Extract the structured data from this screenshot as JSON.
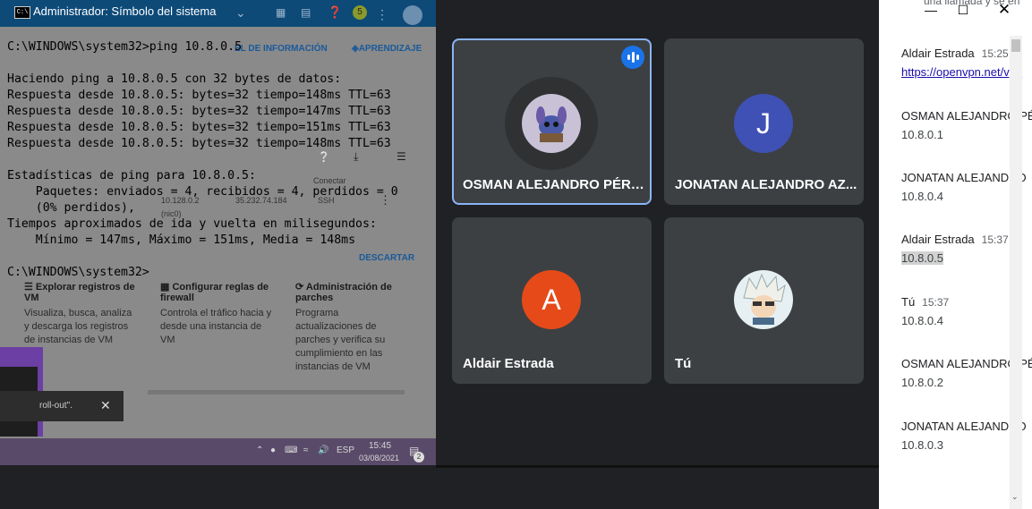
{
  "cmd": {
    "title": "Administrador: Símbolo del sistema",
    "icon": "cmd-icon",
    "lines": [
      "C:\\WINDOWS\\system32>ping 10.8.0.5",
      "",
      "Haciendo ping a 10.8.0.5 con 32 bytes de datos:",
      "Respuesta desde 10.8.0.5: bytes=32 tiempo=148ms TTL=63",
      "Respuesta desde 10.8.0.5: bytes=32 tiempo=147ms TTL=63",
      "Respuesta desde 10.8.0.5: bytes=32 tiempo=151ms TTL=63",
      "Respuesta desde 10.8.0.5: bytes=32 tiempo=148ms TTL=63",
      "",
      "Estadísticas de ping para 10.8.0.5:",
      "    Paquetes: enviados = 4, recibidos = 4, perdidos = 0",
      "    (0% perdidos),",
      "Tiempos aproximados de ida y vuelta en milisegundos:",
      "    Mínimo = 147ms, Máximo = 151ms, Media = 148ms",
      "",
      "C:\\WINDOWS\\system32>"
    ]
  },
  "gcp_bg": {
    "tab_info": "EL DE INFORMACIÓN",
    "tab_learn": "APRENDIZAJE",
    "ip_internal": "10.128.0.2",
    "ip_external": "35.232.74.184",
    "connect_header": "Conectar",
    "ssh": "SSH",
    "nic": "(nic0)",
    "download": "DESCARTAR",
    "cards": [
      {
        "title": "Explorar registros de VM",
        "text": "Visualiza, busca, analiza y descarga los registros de instancias de VM"
      },
      {
        "title": "Configurar reglas de firewall",
        "text": "Controla el tráfico hacia y desde una instancia de VM"
      },
      {
        "title": "Administración de parches",
        "text": "Programa actualizaciones de parches y verifica su cumplimiento en las instancias de VM"
      }
    ],
    "toast_text": "roll-out\".",
    "avatar_number": "5"
  },
  "taskbar": {
    "lang": "ESP",
    "time": "15:45",
    "date": "03/08/2021",
    "notif_count": "2"
  },
  "meet": {
    "tiles": [
      {
        "name": "OSMAN ALEJANDRO PÉRE...",
        "speaking": true
      },
      {
        "name": "JONATAN ALEJANDRO AZ...",
        "initial": "J",
        "color": "#3f51b5"
      },
      {
        "name": "Aldair Estrada",
        "initial": "A",
        "color": "#e64a19"
      },
      {
        "name": "Tú"
      }
    ]
  },
  "chat": {
    "top_fragment": "una llamada y se en",
    "messages": [
      {
        "sender": "Aldair Estrada",
        "time": "15:25",
        "text": "https://openvpn.net/vpn",
        "link": true
      },
      {
        "sender": "OSMAN ALEJANDRO PÉ",
        "time": "",
        "text": "10.8.0.1"
      },
      {
        "sender": "JONATAN ALEJANDRO",
        "time": "",
        "text": "10.8.0.4"
      },
      {
        "sender": "Aldair Estrada",
        "time": "15:37",
        "text": "10.8.0.5",
        "highlight": true
      },
      {
        "sender": "Tú",
        "time": "15:37",
        "text": "10.8.0.4"
      },
      {
        "sender": "OSMAN ALEJANDRO PÉ",
        "time": "",
        "text": "10.8.0.2"
      },
      {
        "sender": "JONATAN ALEJANDRO",
        "time": "",
        "text": "10.8.0.3"
      }
    ]
  }
}
